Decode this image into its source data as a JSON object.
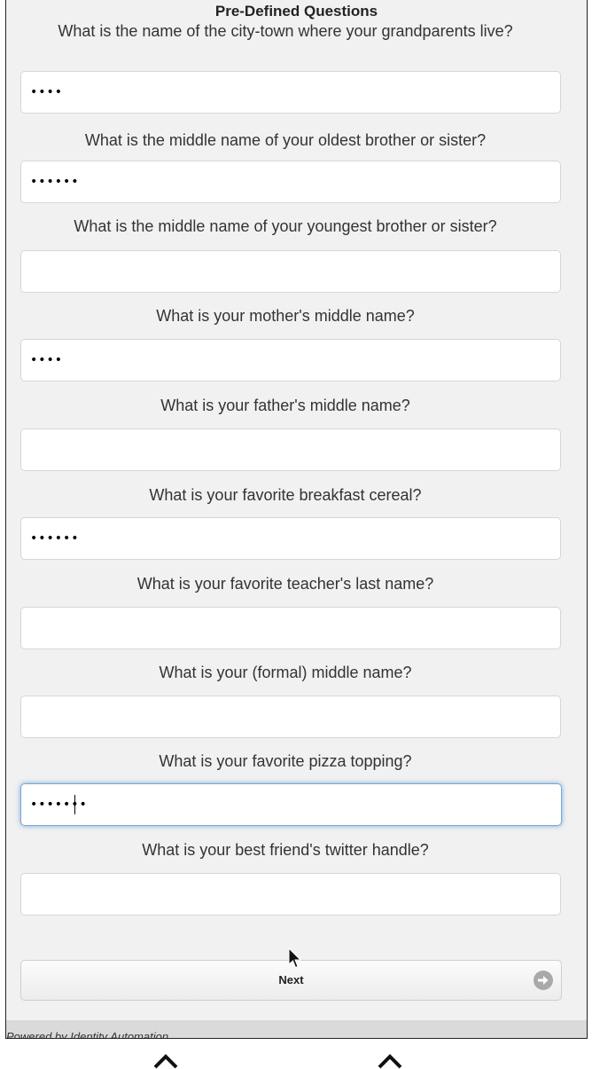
{
  "form": {
    "title": "Pre-Defined Questions",
    "questions": [
      {
        "label": "What is the name of the city-town where your grandparents live?",
        "value": "••••"
      },
      {
        "label": "What is the middle name of your oldest brother or sister?",
        "value": "••••••"
      },
      {
        "label": "What is the middle name of your youngest brother or sister?",
        "value": ""
      },
      {
        "label": "What is your mother's middle name?",
        "value": "••••"
      },
      {
        "label": "What is your father's middle name?",
        "value": ""
      },
      {
        "label": "What is your favorite breakfast cereal?",
        "value": "••••••"
      },
      {
        "label": "What is your favorite teacher's last name?",
        "value": ""
      },
      {
        "label": "What is your (formal) middle name?",
        "value": ""
      },
      {
        "label": "What is your favorite pizza topping?",
        "value": "•••••••"
      },
      {
        "label": "What is your best friend's twitter handle?",
        "value": ""
      }
    ]
  },
  "next_button": {
    "label": "Next",
    "icon": "arrow-right-circle-icon"
  },
  "footer": {
    "text": "Powered by Identity Automation"
  },
  "colors": {
    "panel_bg": "#f1f1f1",
    "footer_bg": "#dadada",
    "focus_glow": "#5291d2"
  }
}
